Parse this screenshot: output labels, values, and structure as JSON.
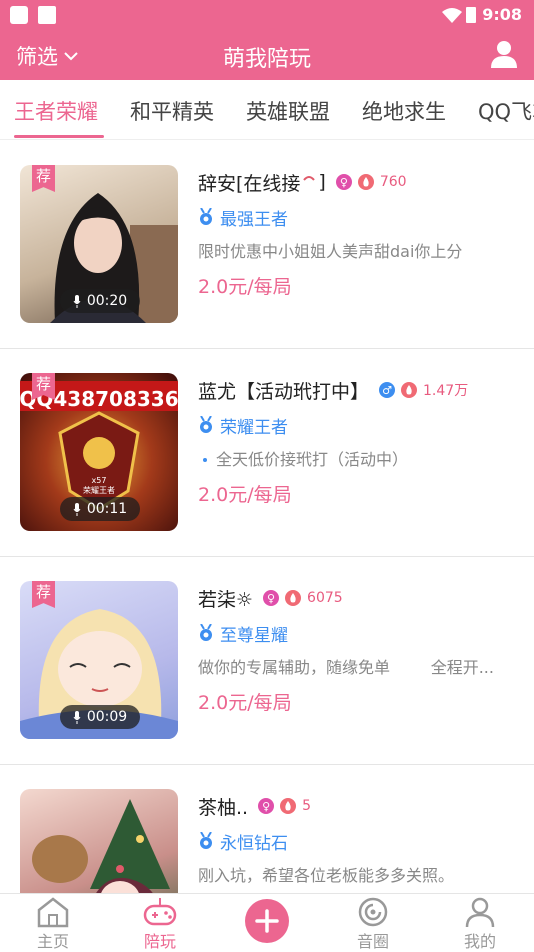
{
  "status": {
    "time": "9:08"
  },
  "header": {
    "filter_label": "筛选",
    "title": "萌我陪玩"
  },
  "tabs": [
    "王者荣耀",
    "和平精英",
    "英雄联盟",
    "绝地求生",
    "QQ飞车"
  ],
  "cards": [
    {
      "badge": "荐",
      "voice": "00:20",
      "name": "辞安[在线接",
      "name_suffix": "]",
      "gender": "♀",
      "heat": "760",
      "rank": "最强王者",
      "desc": "限时优惠中小姐姐人美声甜dai你上分",
      "price": "2.0元/每局"
    },
    {
      "badge": "荐",
      "voice": "00:11",
      "thumb_text": "QQ438708336",
      "thumb_small": "x57",
      "thumb_caption": "荣耀王者",
      "name": "蓝尤【活动玳打中】",
      "gender": "♂",
      "heat": "1.47万",
      "rank": "荣耀王者",
      "desc": "全天低价接玳打（活动中）",
      "price": "2.0元/每局"
    },
    {
      "badge": "荐",
      "voice": "00:09",
      "name": "若柒☼",
      "gender": "♀",
      "heat": "6075",
      "rank": "至尊星耀",
      "desc": "做你的专属辅助，随缘免单        全程开...",
      "price": "2.0元/每局"
    },
    {
      "name": "茶柚..",
      "gender": "♀",
      "heat": "5",
      "rank": "永恒钻石",
      "desc": "刚入坑，希望各位老板能多多关照。"
    }
  ],
  "bottom_nav": {
    "home": "主页",
    "play": "陪玩",
    "circle": "音圈",
    "mine": "我的"
  },
  "colors": {
    "accent": "#ec6690",
    "rank_blue": "#3d8ef0"
  }
}
